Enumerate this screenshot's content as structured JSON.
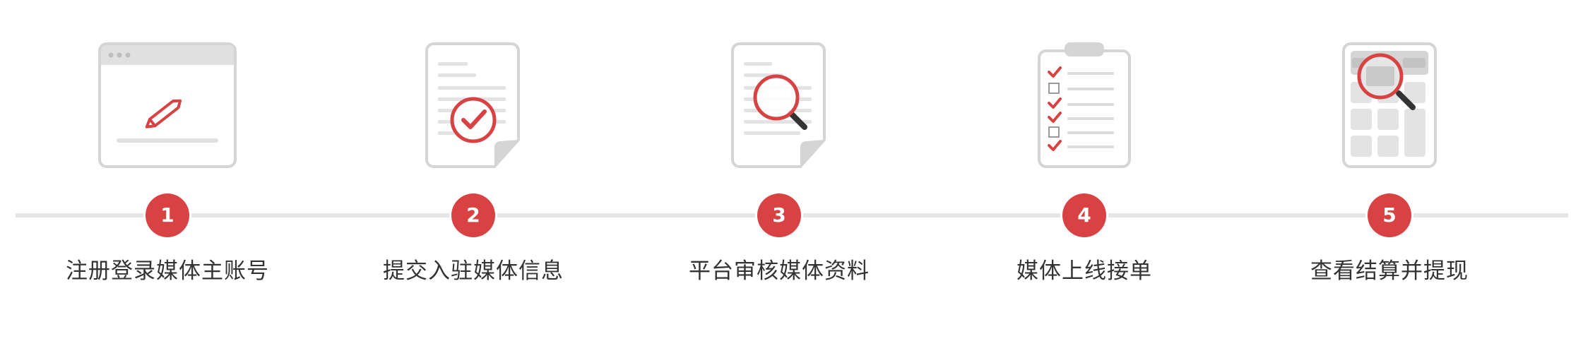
{
  "colors": {
    "accent": "#d84242",
    "icon_gray": "#d5d5d5",
    "line": "#e6e6e6",
    "text": "#333333"
  },
  "steps": [
    {
      "number": "1",
      "label": "注册登录媒体主账号",
      "icon": "browser-pencil-icon"
    },
    {
      "number": "2",
      "label": "提交入驻媒体信息",
      "icon": "document-check-icon"
    },
    {
      "number": "3",
      "label": "平台审核媒体资料",
      "icon": "document-search-icon"
    },
    {
      "number": "4",
      "label": "媒体上线接单",
      "icon": "clipboard-checklist-icon"
    },
    {
      "number": "5",
      "label": "查看结算并提现",
      "icon": "calculator-magnifier-icon"
    }
  ]
}
